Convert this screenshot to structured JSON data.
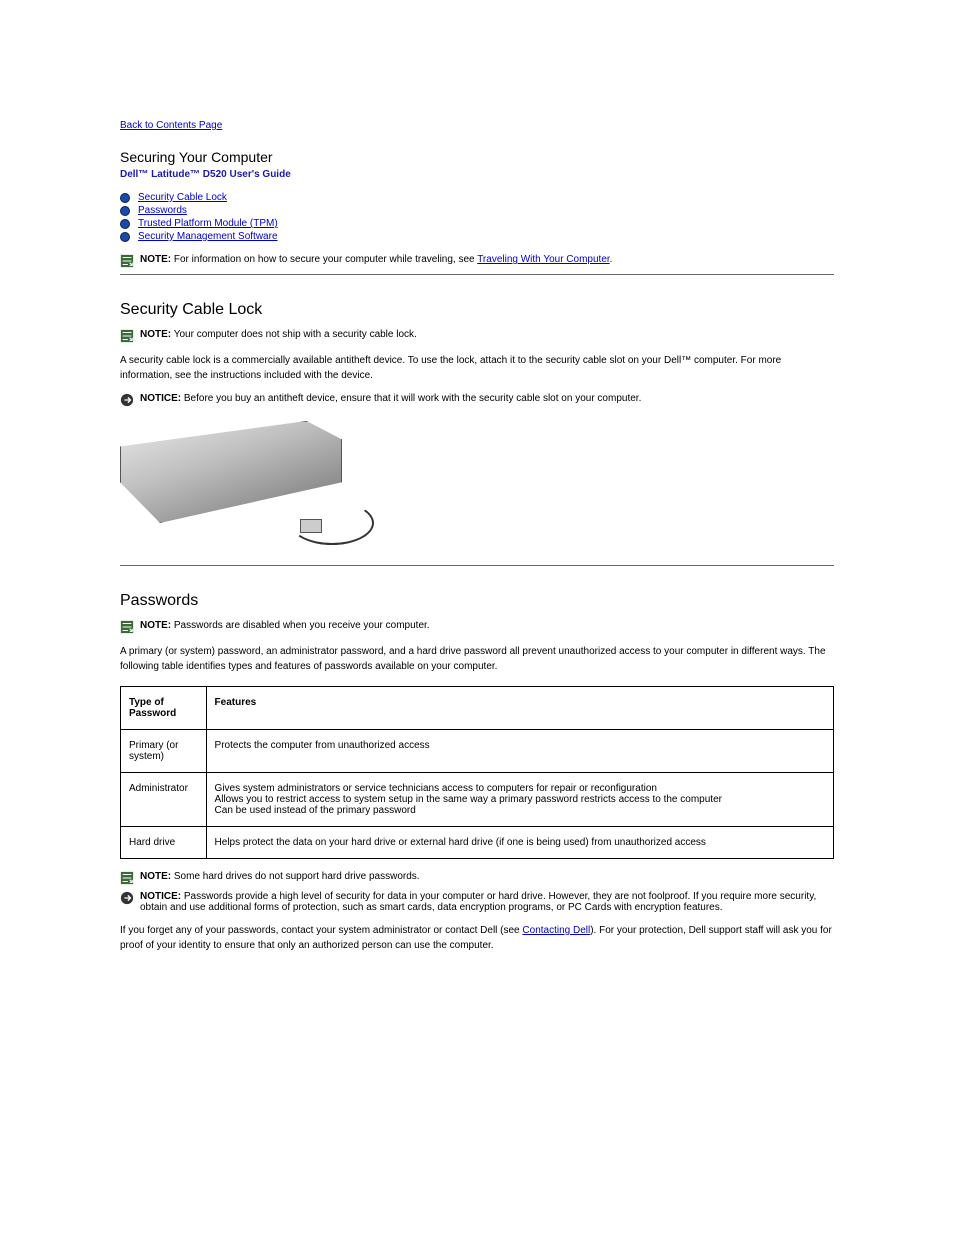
{
  "back_link": "Back to Contents Page",
  "page_title": "Securing Your Computer",
  "subtitle": "Dell™ Latitude™ D520 User's Guide",
  "toc": [
    {
      "label": "Security Cable Lock"
    },
    {
      "label": "Passwords"
    },
    {
      "label": "Trusted Platform Module (TPM)"
    },
    {
      "label": "Security Management Software"
    }
  ],
  "intro_note": {
    "label": "NOTE:",
    "text": "For information on how to secure your computer while traveling, see ",
    "link": "Traveling With Your Computer",
    "after": "."
  },
  "section_cable_lock": {
    "heading": "Security Cable Lock",
    "note": {
      "label": "NOTE:",
      "text": "Your computer does not ship with a security cable lock."
    },
    "para": "A security cable lock is a commercially available antitheft device. To use the lock, attach it to the security cable slot on your Dell™ computer. For more information, see the instructions included with the device.",
    "notice": {
      "label": "NOTICE:",
      "text": "Before you buy an antitheft device, ensure that it will work with the security cable slot on your computer."
    }
  },
  "section_passwords": {
    "heading": "Passwords",
    "note1": {
      "label": "NOTE:",
      "text": "Passwords are disabled when you receive your computer."
    },
    "para1": "A primary (or system) password, an administrator password, and a hard drive password all prevent unauthorized access to your computer in different ways. The following table identifies types and features of passwords available on your computer.",
    "table": {
      "headers": [
        "Type of Password",
        "Features"
      ],
      "rows": [
        {
          "type": "Primary (or system)",
          "features_list": [
            "Protects the computer from unauthorized access"
          ]
        },
        {
          "type": "Administrator",
          "features_list": [
            "Gives system administrators or service technicians access to computers for repair or reconfiguration",
            "Allows you to restrict access to system setup in the same way a primary password restricts access to the computer",
            "Can be used instead of the primary password"
          ]
        },
        {
          "type": "Hard drive",
          "features_list": [
            "Helps protect the data on your hard drive or external hard drive (if one is being used) from unauthorized access"
          ]
        }
      ]
    },
    "note2": {
      "label": "NOTE:",
      "text": "Some hard drives do not support hard drive passwords."
    },
    "notice": {
      "label": "NOTICE:",
      "text_before": "Passwords provide a high level of security for data in your computer or hard drive. However, they are not foolproof. If you require more security, obtain and use additional forms of protection, such as smart cards, data encryption programs, or PC Cards with encryption features."
    },
    "para2_before": "If you forget any of your passwords, contact your system administrator or contact Dell (see ",
    "para2_link": "Contacting Dell",
    "para2_after": "). For your protection, Dell support staff will ask you for proof of your identity to ensure that only an authorized person can use the computer."
  }
}
